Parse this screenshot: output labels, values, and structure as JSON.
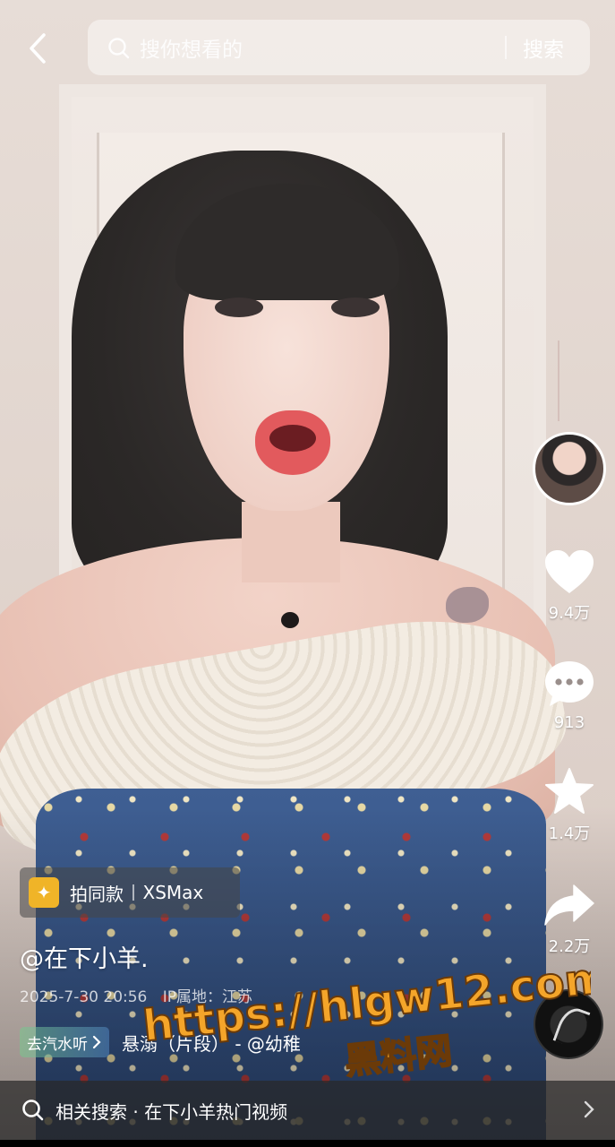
{
  "search": {
    "placeholder": "搜你想看的",
    "submit_label": "搜索"
  },
  "rail": {
    "likes": "9.4万",
    "comments": "913",
    "favorites": "1.4万",
    "shares": "2.2万"
  },
  "template": {
    "label": "拍同款",
    "name": "XSMax"
  },
  "post": {
    "author": "@在下小羊.",
    "date": "2025-7-30 20:56",
    "ip_location": "IP属地：江苏"
  },
  "music": {
    "listen_label": "去汽水听",
    "title": "悬溺（片段） - @幼稚"
  },
  "related": {
    "text": "相关搜索 · 在下小羊热门视频"
  },
  "watermark": {
    "url": "https://hlgw12.com",
    "name": "黑料网"
  },
  "colors": {
    "watermark": "#f4a52a",
    "template_icon": "#f0b428"
  },
  "icons": [
    "back-arrow-icon",
    "search-icon",
    "heart-icon",
    "comment-icon",
    "star-icon",
    "share-icon",
    "sparkle-icon",
    "chevron-right-icon",
    "music-disc-icon"
  ]
}
